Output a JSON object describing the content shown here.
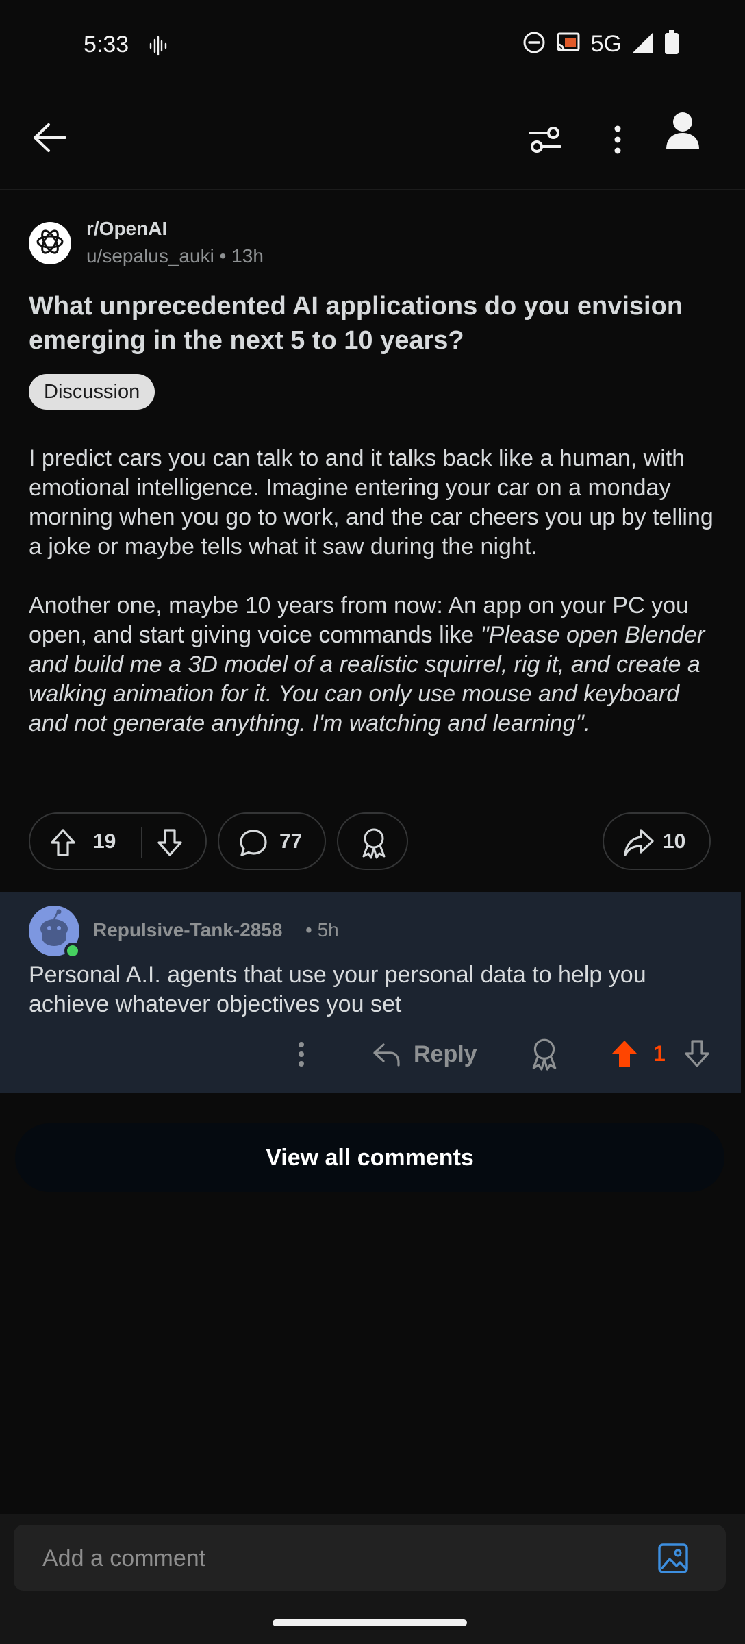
{
  "status_bar": {
    "time": "5:33",
    "network": "5G",
    "icons": [
      "voice-wave-icon",
      "do-not-disturb-icon",
      "cast-icon",
      "signal-icon",
      "battery-icon"
    ]
  },
  "app_bar": {
    "icons": [
      "back-arrow-icon",
      "filter-icon",
      "more-vertical-icon",
      "user-avatar-icon"
    ]
  },
  "post": {
    "subreddit": "r/OpenAI",
    "author": "u/sepalus_auki",
    "age": "13h",
    "title": "What unprecedented AI applications do you envision emerging in the next 5 to 10 years?",
    "flair": "Discussion",
    "body_p1": "I predict cars you can talk to and it talks back like a human, with emotional intelligence. Imagine entering your car on a monday morning when you go to work, and the car cheers you up by telling a joke or maybe tells what it saw during the night.",
    "body_p2_plain": "Another one, maybe 10 years from now: An app on your PC you open, and start giving voice commands like ",
    "body_p2_quote": "\"Please open Blender and build me a 3D model of a realistic squirrel, rig it, and create a walking animation for it. You can only use mouse and keyboard and not generate anything. I'm watching and learning\".",
    "score": "19",
    "comments": "77",
    "shares": "10"
  },
  "comment": {
    "author": "Repulsive-Tank-2858",
    "age": "5h",
    "text": "Personal A.I. agents that use your personal data to help you achieve whatever objectives you set",
    "reply_label": "Reply",
    "score": "1",
    "upvoted": true,
    "upvote_color": "#ff4500"
  },
  "view_all_label": "View all comments",
  "composer": {
    "placeholder": "Add a comment",
    "accent": "#3d8fe0"
  }
}
